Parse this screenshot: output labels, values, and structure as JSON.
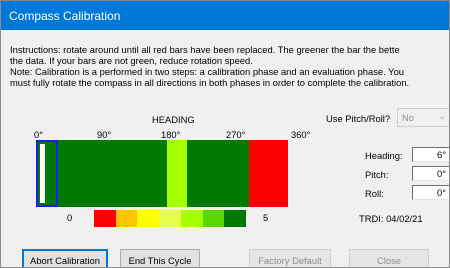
{
  "window": {
    "title": "Compass Calibration",
    "accent": "#0078d7"
  },
  "instructions": [
    "Instructions: rotate around until all red bars have been replaced.  The greener the bar the bette",
    "the data.  If your bars are not green, reduce rotation speed.",
    "Note: Calibration is a performed in two steps: a calibration phase and an evaluation phase.  You",
    "must fully rotate the compass in all directions in both phases in order to complete the calibration."
  ],
  "heading_caption": "HEADING",
  "use_pitch_roll": {
    "label": "Use Pitch/Roll?",
    "value": "No",
    "arrow_icon": "chevron-down-icon"
  },
  "ticks": [
    "0°",
    "90°",
    "180°",
    "270°",
    "360°"
  ],
  "bar": {
    "segments": [
      {
        "color": "#007a00",
        "from_deg": 0,
        "to_deg": 187
      },
      {
        "color": "#a6ff00",
        "from_deg": 187,
        "to_deg": 216
      },
      {
        "color": "#007a00",
        "from_deg": 216,
        "to_deg": 304
      },
      {
        "color": "#ff0000",
        "from_deg": 304,
        "to_deg": 360
      }
    ],
    "cursor_color": "#1a1aff"
  },
  "legend": {
    "min": "0",
    "max": "5",
    "colors": [
      "#ff0000",
      "#ffc400",
      "#ffff00",
      "#e8ff4a",
      "#a6ff00",
      "#5cd600",
      "#007a00"
    ]
  },
  "readouts": [
    {
      "label": "Heading:",
      "value": "6°"
    },
    {
      "label": "Pitch:",
      "value": "0°"
    },
    {
      "label": "Roll:",
      "value": "0°"
    }
  ],
  "trdi": "TRDI: 04/02/21",
  "buttons": {
    "abort": "Abort Calibration",
    "end_cycle": "End This Cycle",
    "factory_default": "Factory Default",
    "close": "Close"
  }
}
